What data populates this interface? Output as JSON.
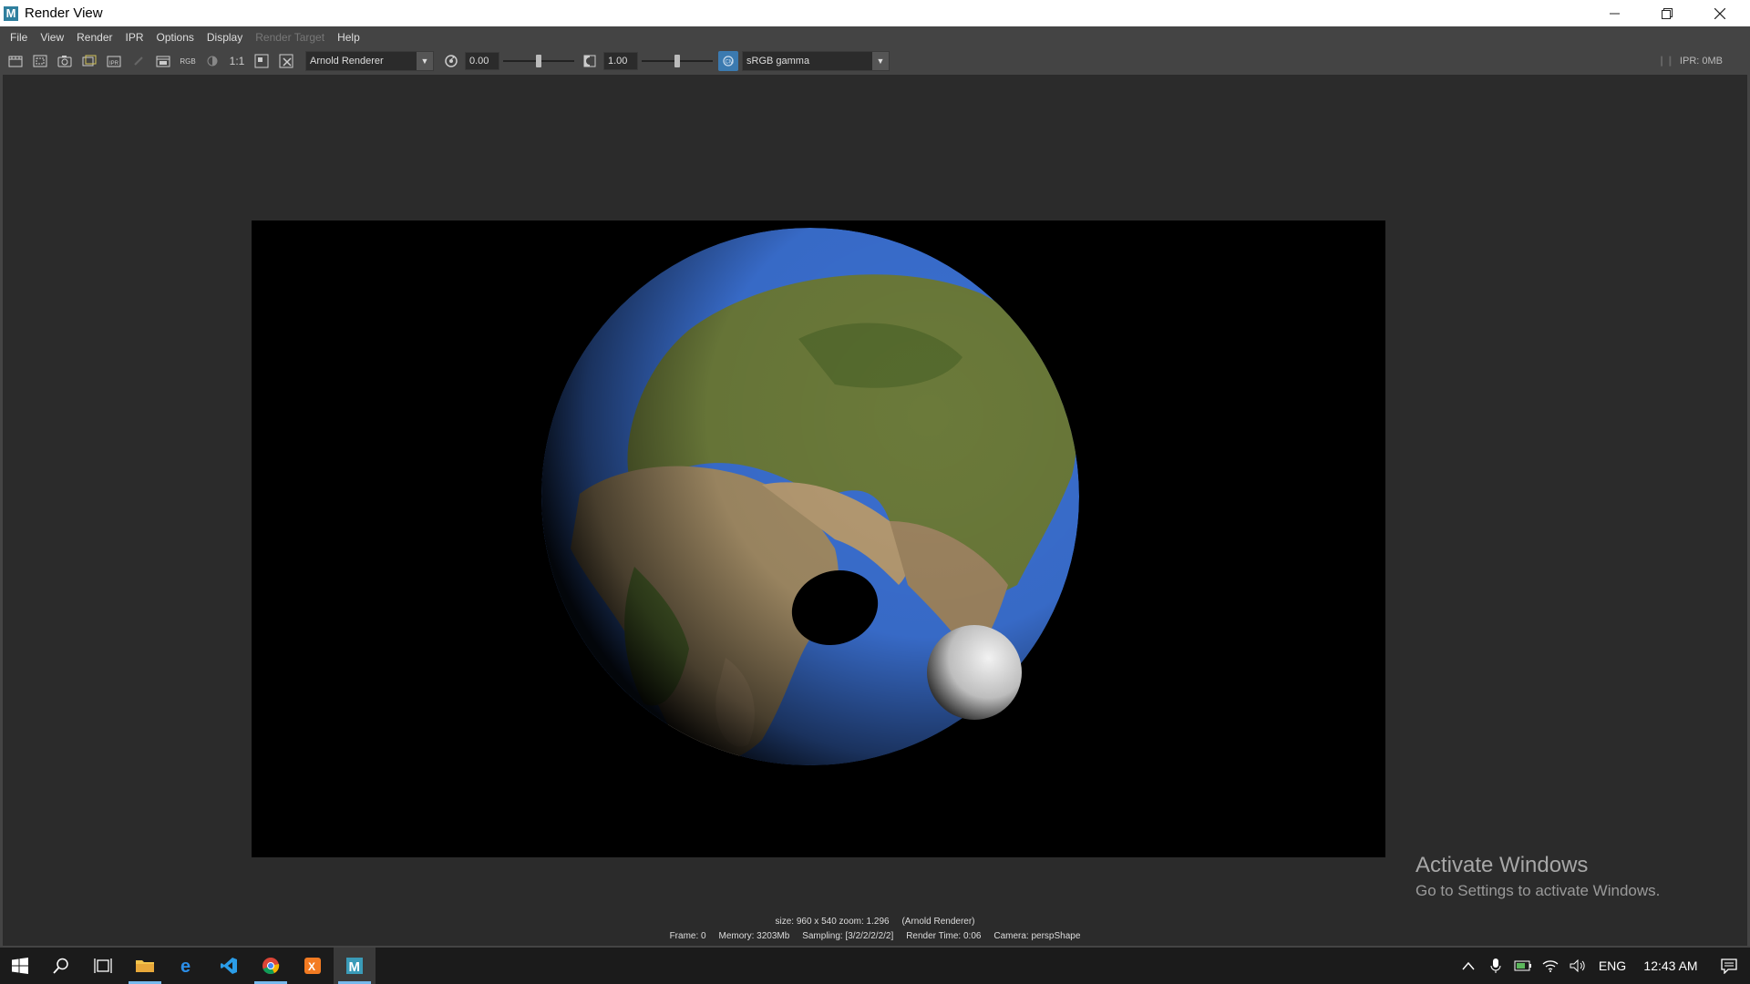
{
  "window": {
    "title": "Render View",
    "app_icon": "maya-icon"
  },
  "menu": [
    "File",
    "View",
    "Render",
    "IPR",
    "Options",
    "Display",
    "Render Target",
    "Help"
  ],
  "menu_disabled": [
    "Render Target"
  ],
  "toolbar": {
    "ratio_label": "1:1",
    "rgb_label": "RGB",
    "renderer": "Arnold Renderer",
    "exposure_value": "0.00",
    "gamma_value": "1.00",
    "exposure_level": 0.5,
    "gamma_level": 0.5,
    "color_space": "sRGB gamma",
    "ipr_memory": "IPR: 0MB"
  },
  "status": {
    "line1_size": "size: 960 x 540 zoom: 1.296",
    "line1_renderer": "(Arnold Renderer)",
    "frame": "Frame: 0",
    "memory": "Memory: 3203Mb",
    "sampling": "Sampling: [3/2/2/2/2/2]",
    "render_time": "Render Time: 0:06",
    "camera": "Camera: perspShape"
  },
  "watermark": {
    "heading": "Activate Windows",
    "sub": "Go to Settings to activate Windows."
  },
  "taskbar": {
    "apps": [
      "start-icon",
      "search-icon",
      "task-view-icon",
      "file-explorer-icon",
      "edge-icon",
      "vscode-icon",
      "chrome-icon",
      "xampp-icon",
      "maya-icon"
    ],
    "language": "ENG",
    "time": "12:43 AM"
  },
  "colors": {
    "ocean": "#3a6fd0",
    "accent": "#76b9ed"
  }
}
